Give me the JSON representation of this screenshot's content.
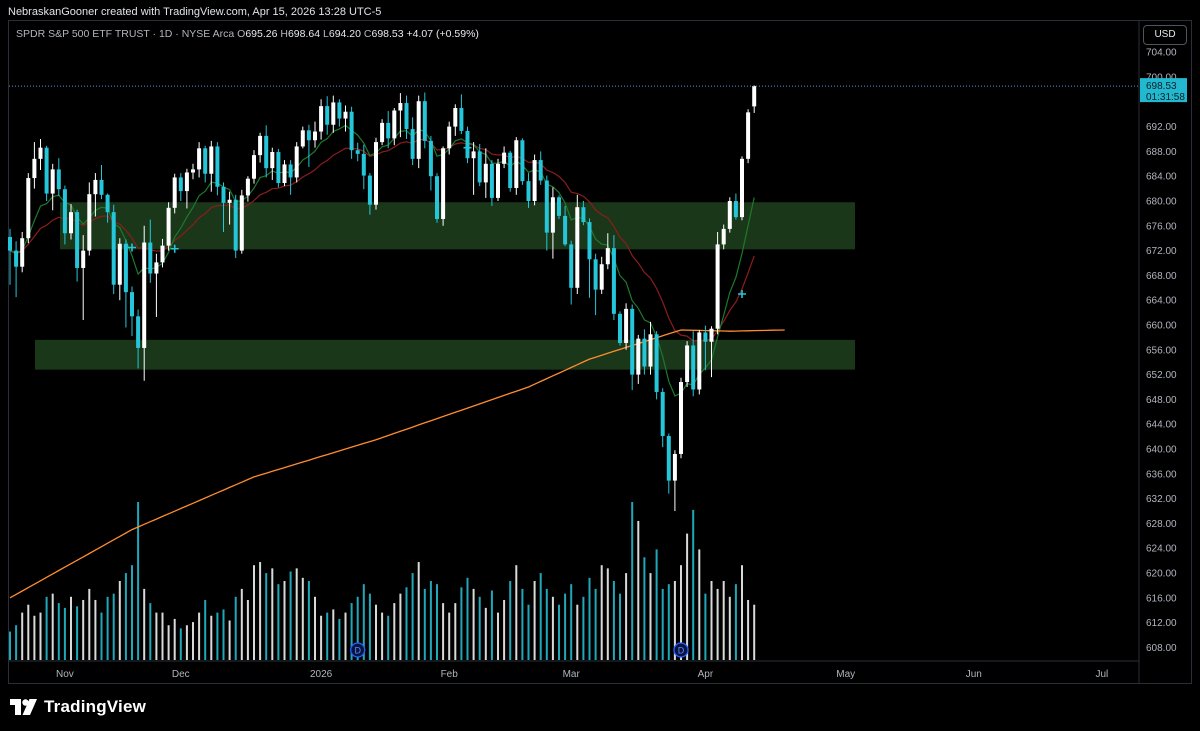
{
  "header": {
    "credit": "NebraskanGooner created with TradingView.com, Apr 15, 2026 13:28 UTC-5",
    "symbol": "SPDR S&P 500 ETF TRUST · 1D · NYSE Arca",
    "o_label": "O",
    "o_value": "695.26",
    "h_label": "H",
    "h_value": "698.64",
    "l_label": "L",
    "l_value": "694.20",
    "c_label": "C",
    "c_value": "698.53",
    "change": "+4.07 (+0.59%)"
  },
  "currency_button": "USD",
  "price_tag": {
    "price": "698.53",
    "countdown": "01:31:58"
  },
  "brand": {
    "name": "TradingView"
  },
  "colors": {
    "background": "#000000",
    "bull": "#ffffff",
    "bear": "#26c6da",
    "zone": "#1d3d1d",
    "ema_green": "#1b7a2c",
    "ema_red": "#8b1d1d",
    "sma_orange": "#ff8c2e",
    "dividend": "#2962ff"
  },
  "chart_data": {
    "type": "candlestick",
    "title": "SPDR S&P 500 ETF TRUST · 1D · NYSE Arca",
    "y_axis": {
      "position": "right",
      "ylim": [
        606,
        706
      ],
      "ticks": [
        "608.00",
        "612.00",
        "616.00",
        "620.00",
        "624.00",
        "628.00",
        "632.00",
        "636.00",
        "640.00",
        "644.00",
        "648.00",
        "652.00",
        "656.00",
        "660.00",
        "664.00",
        "668.00",
        "672.00",
        "676.00",
        "680.00",
        "684.00",
        "688.00",
        "692.00",
        "700.00",
        "704.00"
      ]
    },
    "x_axis": {
      "ticks": [
        "Nov",
        "Dec",
        "2026",
        "Feb",
        "Mar",
        "Apr",
        "May",
        "Jun",
        "Jul"
      ]
    },
    "candles": [
      {
        "o": 674.2,
        "h": 675.5,
        "l": 666.5,
        "c": 672.0
      },
      {
        "o": 672.0,
        "h": 673.5,
        "l": 664.5,
        "c": 669.4
      },
      {
        "o": 669.4,
        "h": 675.0,
        "l": 668.5,
        "c": 674.0
      },
      {
        "o": 674.0,
        "h": 684.5,
        "l": 673.2,
        "c": 683.7
      },
      {
        "o": 683.7,
        "h": 689.5,
        "l": 682.0,
        "c": 686.8
      },
      {
        "o": 686.8,
        "h": 690.0,
        "l": 685.0,
        "c": 688.6
      },
      {
        "o": 688.6,
        "h": 688.9,
        "l": 680.0,
        "c": 681.2
      },
      {
        "o": 681.2,
        "h": 686.0,
        "l": 678.5,
        "c": 685.1
      },
      {
        "o": 685.1,
        "h": 686.9,
        "l": 680.8,
        "c": 681.9
      },
      {
        "o": 681.9,
        "h": 682.5,
        "l": 673.0,
        "c": 674.8
      },
      {
        "o": 674.8,
        "h": 679.5,
        "l": 673.8,
        "c": 678.2
      },
      {
        "o": 678.2,
        "h": 678.6,
        "l": 667.0,
        "c": 669.2
      },
      {
        "o": 669.2,
        "h": 674.5,
        "l": 660.8,
        "c": 672.0
      },
      {
        "o": 672.0,
        "h": 683.0,
        "l": 671.2,
        "c": 681.1
      },
      {
        "o": 681.1,
        "h": 684.5,
        "l": 677.5,
        "c": 683.4
      },
      {
        "o": 683.4,
        "h": 685.8,
        "l": 680.3,
        "c": 681.0
      },
      {
        "o": 681.0,
        "h": 681.2,
        "l": 676.5,
        "c": 678.2
      },
      {
        "o": 678.2,
        "h": 679.4,
        "l": 665.0,
        "c": 666.5
      },
      {
        "o": 666.5,
        "h": 674.0,
        "l": 664.0,
        "c": 673.1
      },
      {
        "o": 673.1,
        "h": 673.8,
        "l": 659.6,
        "c": 665.3
      },
      {
        "o": 665.3,
        "h": 666.2,
        "l": 658.2,
        "c": 661.4
      },
      {
        "o": 661.4,
        "h": 662.5,
        "l": 653.0,
        "c": 656.3
      },
      {
        "o": 656.3,
        "h": 676.0,
        "l": 651.0,
        "c": 673.3
      },
      {
        "o": 673.3,
        "h": 677.0,
        "l": 666.8,
        "c": 668.3
      },
      {
        "o": 668.3,
        "h": 671.5,
        "l": 661.3,
        "c": 670.1
      },
      {
        "o": 670.1,
        "h": 673.9,
        "l": 669.3,
        "c": 672.8
      },
      {
        "o": 672.8,
        "h": 679.8,
        "l": 672.0,
        "c": 678.9
      },
      {
        "o": 678.9,
        "h": 684.4,
        "l": 678.0,
        "c": 683.8
      },
      {
        "o": 683.8,
        "h": 684.5,
        "l": 680.0,
        "c": 681.6
      },
      {
        "o": 681.6,
        "h": 685.2,
        "l": 678.8,
        "c": 684.6
      },
      {
        "o": 684.6,
        "h": 686.0,
        "l": 683.5,
        "c": 685.1
      },
      {
        "o": 685.1,
        "h": 689.5,
        "l": 683.8,
        "c": 688.5
      },
      {
        "o": 688.5,
        "h": 688.9,
        "l": 683.0,
        "c": 684.4
      },
      {
        "o": 684.4,
        "h": 689.7,
        "l": 681.5,
        "c": 688.8
      },
      {
        "o": 688.8,
        "h": 689.5,
        "l": 680.9,
        "c": 682.3
      },
      {
        "o": 682.3,
        "h": 683.0,
        "l": 675.0,
        "c": 679.7
      },
      {
        "o": 679.7,
        "h": 681.5,
        "l": 676.2,
        "c": 680.2
      },
      {
        "o": 680.2,
        "h": 681.0,
        "l": 670.8,
        "c": 672.0
      },
      {
        "o": 672.0,
        "h": 681.8,
        "l": 671.5,
        "c": 680.9
      },
      {
        "o": 680.9,
        "h": 684.0,
        "l": 679.9,
        "c": 683.6
      },
      {
        "o": 683.6,
        "h": 688.2,
        "l": 682.8,
        "c": 687.4
      },
      {
        "o": 687.4,
        "h": 691.0,
        "l": 686.2,
        "c": 690.5
      },
      {
        "o": 690.5,
        "h": 692.2,
        "l": 683.8,
        "c": 685.3
      },
      {
        "o": 685.3,
        "h": 688.6,
        "l": 683.4,
        "c": 687.9
      },
      {
        "o": 687.9,
        "h": 688.4,
        "l": 682.2,
        "c": 682.9
      },
      {
        "o": 682.9,
        "h": 686.6,
        "l": 682.4,
        "c": 685.9
      },
      {
        "o": 685.9,
        "h": 686.6,
        "l": 681.0,
        "c": 683.8
      },
      {
        "o": 683.8,
        "h": 689.5,
        "l": 683.0,
        "c": 688.8
      },
      {
        "o": 688.8,
        "h": 692.0,
        "l": 688.5,
        "c": 691.4
      },
      {
        "o": 691.4,
        "h": 692.3,
        "l": 685.5,
        "c": 689.8
      },
      {
        "o": 689.8,
        "h": 692.8,
        "l": 688.6,
        "c": 691.2
      },
      {
        "o": 691.2,
        "h": 696.4,
        "l": 689.9,
        "c": 695.3
      },
      {
        "o": 695.3,
        "h": 696.9,
        "l": 690.7,
        "c": 692.3
      },
      {
        "o": 692.3,
        "h": 697.0,
        "l": 691.0,
        "c": 695.9
      },
      {
        "o": 695.9,
        "h": 696.4,
        "l": 692.0,
        "c": 693.3
      },
      {
        "o": 693.3,
        "h": 695.4,
        "l": 691.2,
        "c": 694.4
      },
      {
        "o": 694.4,
        "h": 695.2,
        "l": 686.8,
        "c": 688.2
      },
      {
        "o": 688.2,
        "h": 689.4,
        "l": 686.4,
        "c": 687.6
      },
      {
        "o": 687.6,
        "h": 689.1,
        "l": 681.9,
        "c": 684.1
      },
      {
        "o": 684.1,
        "h": 684.5,
        "l": 677.8,
        "c": 679.4
      },
      {
        "o": 679.4,
        "h": 690.2,
        "l": 678.6,
        "c": 689.5
      },
      {
        "o": 689.5,
        "h": 693.2,
        "l": 689.0,
        "c": 692.6
      },
      {
        "o": 692.6,
        "h": 694.5,
        "l": 688.5,
        "c": 690.1
      },
      {
        "o": 690.1,
        "h": 695.0,
        "l": 689.0,
        "c": 694.6
      },
      {
        "o": 694.6,
        "h": 697.4,
        "l": 690.3,
        "c": 695.8
      },
      {
        "o": 695.8,
        "h": 697.0,
        "l": 690.0,
        "c": 691.6
      },
      {
        "o": 691.6,
        "h": 693.5,
        "l": 685.8,
        "c": 686.8
      },
      {
        "o": 686.8,
        "h": 697.0,
        "l": 685.3,
        "c": 696.1
      },
      {
        "o": 696.1,
        "h": 697.5,
        "l": 688.5,
        "c": 689.7
      },
      {
        "o": 689.7,
        "h": 690.5,
        "l": 681.7,
        "c": 684.0
      },
      {
        "o": 684.0,
        "h": 684.5,
        "l": 676.5,
        "c": 677.1
      },
      {
        "o": 677.1,
        "h": 688.8,
        "l": 676.0,
        "c": 688.5
      },
      {
        "o": 688.5,
        "h": 692.8,
        "l": 687.5,
        "c": 692.0
      },
      {
        "o": 692.0,
        "h": 695.6,
        "l": 690.5,
        "c": 695.0
      },
      {
        "o": 695.0,
        "h": 697.2,
        "l": 690.8,
        "c": 691.3
      },
      {
        "o": 691.3,
        "h": 692.0,
        "l": 686.1,
        "c": 686.9
      },
      {
        "o": 686.9,
        "h": 689.5,
        "l": 681.0,
        "c": 688.0
      },
      {
        "o": 688.0,
        "h": 689.2,
        "l": 682.4,
        "c": 683.0
      },
      {
        "o": 683.0,
        "h": 688.5,
        "l": 680.5,
        "c": 686.0
      },
      {
        "o": 686.0,
        "h": 686.6,
        "l": 679.2,
        "c": 680.5
      },
      {
        "o": 680.5,
        "h": 686.8,
        "l": 680.0,
        "c": 686.0
      },
      {
        "o": 686.0,
        "h": 688.8,
        "l": 685.3,
        "c": 687.8
      },
      {
        "o": 687.8,
        "h": 688.1,
        "l": 681.5,
        "c": 682.1
      },
      {
        "o": 682.1,
        "h": 690.3,
        "l": 681.0,
        "c": 689.8
      },
      {
        "o": 689.8,
        "h": 690.1,
        "l": 682.6,
        "c": 683.2
      },
      {
        "o": 683.2,
        "h": 684.5,
        "l": 678.9,
        "c": 680.0
      },
      {
        "o": 680.0,
        "h": 687.5,
        "l": 679.3,
        "c": 686.6
      },
      {
        "o": 686.6,
        "h": 688.0,
        "l": 682.6,
        "c": 683.3
      },
      {
        "o": 683.3,
        "h": 684.1,
        "l": 672.0,
        "c": 674.9
      },
      {
        "o": 674.9,
        "h": 682.2,
        "l": 670.7,
        "c": 680.6
      },
      {
        "o": 680.6,
        "h": 680.9,
        "l": 677.1,
        "c": 677.6
      },
      {
        "o": 677.6,
        "h": 679.2,
        "l": 672.7,
        "c": 673.0
      },
      {
        "o": 673.0,
        "h": 673.6,
        "l": 663.3,
        "c": 666.0
      },
      {
        "o": 666.0,
        "h": 681.0,
        "l": 665.0,
        "c": 679.0
      },
      {
        "o": 679.0,
        "h": 680.0,
        "l": 676.1,
        "c": 676.6
      },
      {
        "o": 676.6,
        "h": 677.2,
        "l": 664.4,
        "c": 670.6
      },
      {
        "o": 670.6,
        "h": 671.5,
        "l": 661.6,
        "c": 665.7
      },
      {
        "o": 665.7,
        "h": 671.0,
        "l": 665.0,
        "c": 669.8
      },
      {
        "o": 669.8,
        "h": 674.8,
        "l": 669.0,
        "c": 672.4
      },
      {
        "o": 672.4,
        "h": 674.5,
        "l": 660.8,
        "c": 661.8
      },
      {
        "o": 661.8,
        "h": 662.2,
        "l": 656.7,
        "c": 657.1
      },
      {
        "o": 657.1,
        "h": 663.5,
        "l": 656.0,
        "c": 662.6
      },
      {
        "o": 662.6,
        "h": 663.3,
        "l": 649.5,
        "c": 652.0
      },
      {
        "o": 652.0,
        "h": 658.4,
        "l": 650.5,
        "c": 657.8
      },
      {
        "o": 657.8,
        "h": 659.3,
        "l": 652.0,
        "c": 653.3
      },
      {
        "o": 653.3,
        "h": 660.5,
        "l": 652.0,
        "c": 658.5
      },
      {
        "o": 658.5,
        "h": 659.0,
        "l": 648.0,
        "c": 649.2
      },
      {
        "o": 649.2,
        "h": 649.8,
        "l": 640.3,
        "c": 642.1
      },
      {
        "o": 642.1,
        "h": 642.5,
        "l": 632.8,
        "c": 634.9
      },
      {
        "o": 634.9,
        "h": 639.8,
        "l": 630.0,
        "c": 639.2
      },
      {
        "o": 639.2,
        "h": 651.5,
        "l": 638.5,
        "c": 650.8
      },
      {
        "o": 650.8,
        "h": 657.4,
        "l": 650.0,
        "c": 656.7
      },
      {
        "o": 656.7,
        "h": 659.0,
        "l": 648.5,
        "c": 649.6
      },
      {
        "o": 649.6,
        "h": 659.2,
        "l": 648.8,
        "c": 658.8
      },
      {
        "o": 658.8,
        "h": 659.9,
        "l": 652.7,
        "c": 657.3
      },
      {
        "o": 657.3,
        "h": 659.8,
        "l": 651.6,
        "c": 659.4
      },
      {
        "o": 659.4,
        "h": 675.0,
        "l": 658.5,
        "c": 673.0
      },
      {
        "o": 673.0,
        "h": 676.2,
        "l": 672.2,
        "c": 675.5
      },
      {
        "o": 675.5,
        "h": 680.6,
        "l": 674.9,
        "c": 680.0
      },
      {
        "o": 680.0,
        "h": 681.2,
        "l": 677.0,
        "c": 677.4
      },
      {
        "o": 677.4,
        "h": 687.2,
        "l": 676.9,
        "c": 686.8
      },
      {
        "o": 686.8,
        "h": 694.8,
        "l": 686.1,
        "c": 694.3
      },
      {
        "o": 695.26,
        "h": 698.64,
        "l": 694.2,
        "c": 698.53
      }
    ],
    "volume_relative": [
      0.18,
      0.22,
      0.3,
      0.35,
      0.28,
      0.3,
      0.4,
      0.42,
      0.36,
      0.33,
      0.4,
      0.34,
      0.38,
      0.45,
      0.38,
      0.3,
      0.4,
      0.42,
      0.5,
      0.55,
      0.6,
      1.0,
      0.45,
      0.36,
      0.3,
      0.3,
      0.22,
      0.26,
      0.2,
      0.22,
      0.24,
      0.3,
      0.38,
      0.28,
      0.3,
      0.32,
      0.25,
      0.4,
      0.45,
      0.38,
      0.6,
      0.62,
      0.55,
      0.58,
      0.48,
      0.5,
      0.56,
      0.58,
      0.52,
      0.5,
      0.4,
      0.28,
      0.3,
      0.32,
      0.26,
      0.3,
      0.36,
      0.4,
      0.48,
      0.42,
      0.35,
      0.3,
      0.28,
      0.36,
      0.42,
      0.46,
      0.55,
      0.62,
      0.45,
      0.5,
      0.48,
      0.36,
      0.3,
      0.36,
      0.46,
      0.52,
      0.45,
      0.4,
      0.33,
      0.44,
      0.3,
      0.38,
      0.5,
      0.6,
      0.45,
      0.35,
      0.5,
      0.55,
      0.45,
      0.4,
      0.35,
      0.42,
      0.48,
      0.35,
      0.4,
      0.52,
      0.45,
      0.6,
      0.58,
      0.5,
      0.42,
      0.55,
      1.0,
      0.88,
      0.65,
      0.55,
      0.7,
      0.45,
      0.48,
      0.5,
      0.6,
      0.8,
      0.95,
      0.7,
      0.42,
      0.5,
      0.45,
      0.5,
      0.4,
      0.48,
      0.6,
      0.38,
      0.35,
      0.3,
      0.36,
      0.3,
      0.23,
      0.2,
      0.2
    ],
    "zones": [
      {
        "name": "upper support/resistance zone",
        "low": 672.2,
        "high": 679.8
      },
      {
        "name": "lower support/resistance zone",
        "low": 652.8,
        "high": 657.6
      }
    ],
    "sma_orange": [
      [
        0,
        616.0
      ],
      [
        20,
        627.0
      ],
      [
        40,
        635.5
      ],
      [
        60,
        641.5
      ],
      [
        85,
        650.0
      ],
      [
        95,
        654.5
      ],
      [
        110,
        659.2
      ],
      [
        118,
        659.0
      ],
      [
        127,
        659.2
      ]
    ],
    "dividends": [
      {
        "index": 57,
        "label": "D"
      },
      {
        "index": 110,
        "label": "D"
      }
    ],
    "last_price": 698.53,
    "grid": false,
    "legend": "none"
  }
}
